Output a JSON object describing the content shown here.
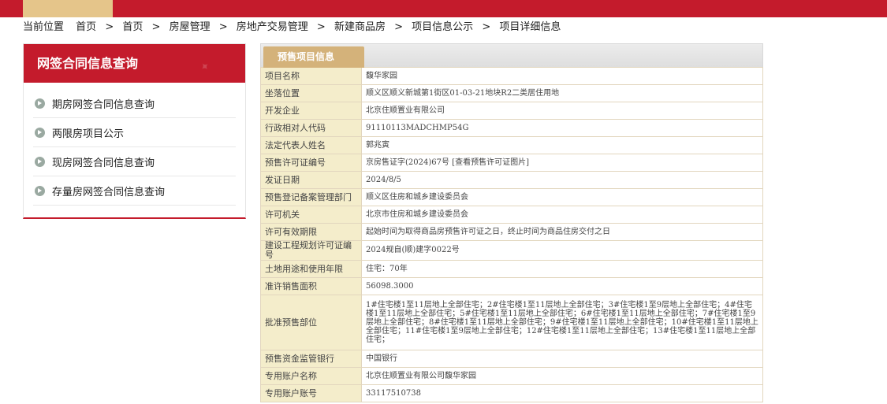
{
  "breadcrumb": {
    "lead": "当前位置",
    "items": [
      "首页",
      "首页",
      "房屋管理",
      "房地产交易管理",
      "新建商品房",
      "项目信息公示",
      "项目详细信息"
    ],
    "separator": ">"
  },
  "sidebar": {
    "title": "网签合同信息查询",
    "items": [
      {
        "label": "期房网签合同信息查询"
      },
      {
        "label": "两限房项目公示"
      },
      {
        "label": "现房网签合同信息查询"
      },
      {
        "label": "存量房网签合同信息查询"
      }
    ]
  },
  "panel": {
    "tab_label": "预售项目信息",
    "rows": [
      {
        "key": "项目名称",
        "value": "馥华家园"
      },
      {
        "key": "坐落位置",
        "value": "顺义区顺义新城第1街区01-03-21地块R2二类居住用地"
      },
      {
        "key": "开发企业",
        "value": "北京住顺置业有限公司"
      },
      {
        "key": "行政相对人代码",
        "value": "91110113MADCHMP54G"
      },
      {
        "key": "法定代表人姓名",
        "value": "郭兆寅"
      },
      {
        "key": "预售许可证编号",
        "value": "京房售证字(2024)67号",
        "link": "[查看预售许可证图片]"
      },
      {
        "key": "发证日期",
        "value": "2024/8/5"
      },
      {
        "key": "预售登记备案管理部门",
        "value": "顺义区住房和城乡建设委员会"
      },
      {
        "key": "许可机关",
        "value": "北京市住房和城乡建设委员会"
      },
      {
        "key": "许可有效期限",
        "value": "起始时间为取得商品房预售许可证之日，终止时间为商品住房交付之日"
      },
      {
        "key": "建设工程规划许可证编号",
        "value": "2024规自(顺)建字0022号"
      },
      {
        "key": "土地用途和使用年限",
        "value": "住宅：70年"
      },
      {
        "key": "准许销售面积",
        "value": "56098.3000"
      },
      {
        "key": "批准预售部位",
        "value": "1#住宅楼1至11层地上全部住宅；2#住宅楼1至11层地上全部住宅；3#住宅楼1至9层地上全部住宅；4#住宅楼1至11层地上全部住宅；5#住宅楼1至11层地上全部住宅；6#住宅楼1至11层地上全部住宅；7#住宅楼1至9层地上全部住宅；8#住宅楼1至11层地上全部住宅；9#住宅楼1至11层地上全部住宅；10#住宅楼1至11层地上全部住宅；11#住宅楼1至9层地上全部住宅；12#住宅楼1至11层地上全部住宅；13#住宅楼1至11层地上全部住宅；"
      },
      {
        "key": "预售资金监管银行",
        "value": "中国银行"
      },
      {
        "key": "专用账户名称",
        "value": "北京住顺置业有限公司馥华家园"
      },
      {
        "key": "专用账户账号",
        "value": "33117510738"
      }
    ]
  },
  "colors": {
    "brand_red": "#c41b2c",
    "gold": "#d4b27a",
    "key_cell_bg": "#f4edcb"
  }
}
